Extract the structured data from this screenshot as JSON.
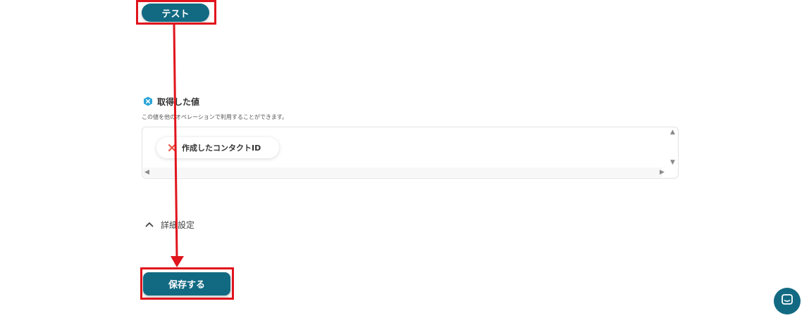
{
  "buttons": {
    "test_label": "テスト",
    "save_label": "保存する"
  },
  "result_section": {
    "title": "取得した値",
    "description": "この値を他のオペレーションで利用することができます。",
    "chip_label": "作成したコンタクトID"
  },
  "advanced": {
    "label": "詳細設定"
  },
  "colors": {
    "primary": "#126a82",
    "annotation_red": "#e0141c",
    "chip_x": "#e8533f",
    "section_icon": "#2aa5d6"
  },
  "icons": {
    "section": "hexagon-x-icon",
    "chip": "x-icon",
    "advanced": "chevron-up-icon",
    "chat": "chat-icon"
  }
}
